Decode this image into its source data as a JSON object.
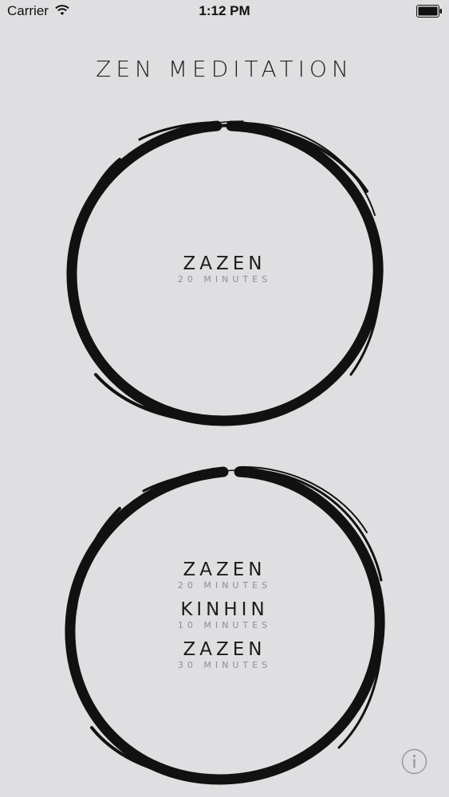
{
  "status_bar": {
    "carrier": "Carrier",
    "time": "1:12 PM",
    "wifi_icon": "wifi-icon",
    "battery_icon": "battery-full-icon"
  },
  "app": {
    "title": "ZEN MEDITATION"
  },
  "sessions": [
    {
      "steps": [
        {
          "name": "ZAZEN",
          "duration": "20 MINUTES"
        }
      ]
    },
    {
      "steps": [
        {
          "name": "ZAZEN",
          "duration": "20 MINUTES"
        },
        {
          "name": "KINHIN",
          "duration": "10 MINUTES"
        },
        {
          "name": "ZAZEN",
          "duration": "30 MINUTES"
        }
      ]
    }
  ],
  "info_icon": "info-icon",
  "colors": {
    "background": "#dfdfe1",
    "ink": "#111111",
    "subtext": "#8f8f93"
  }
}
